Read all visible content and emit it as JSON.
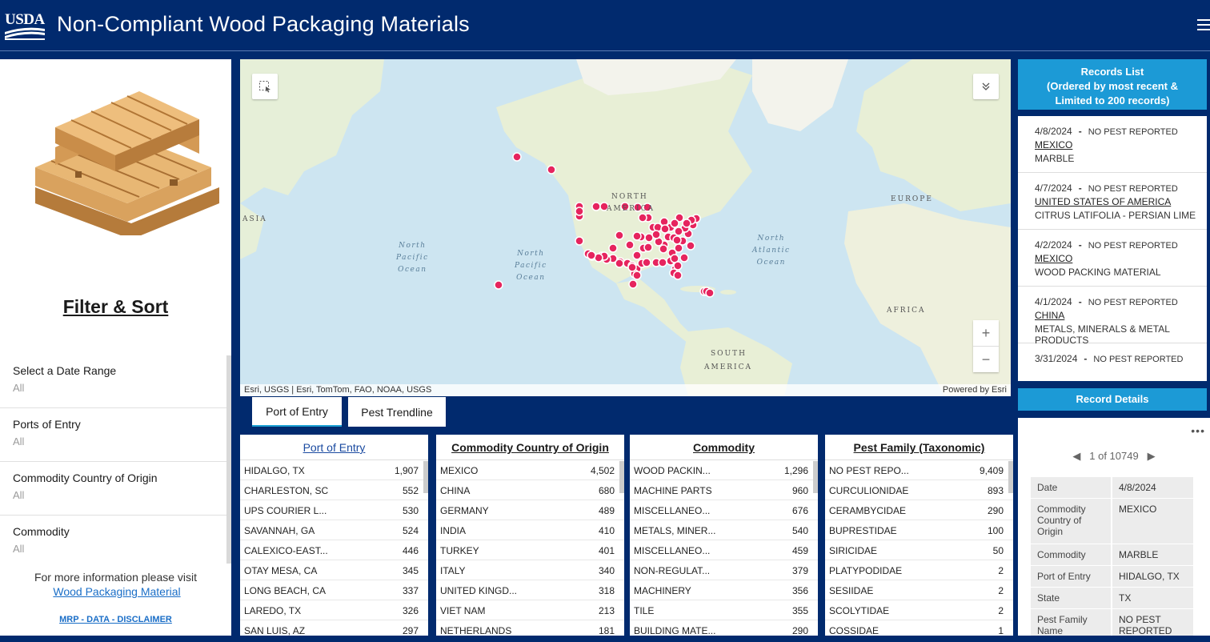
{
  "header": {
    "logo_text": "USDA",
    "title": "Non-Compliant Wood Packaging Materials"
  },
  "left": {
    "filter_title": "Filter & Sort",
    "filters": [
      {
        "label": "Select a Date Range",
        "value": "All"
      },
      {
        "label": "Ports of Entry",
        "value": "All"
      },
      {
        "label": "Commodity Country of Origin",
        "value": "All"
      },
      {
        "label": "Commodity",
        "value": "All"
      }
    ],
    "more_info": "For more information please visit",
    "more_link": "Wood Packaging Material",
    "mrp_link": "MRP - DATA - DISCLAIMER"
  },
  "map": {
    "labels": {
      "asia": "ASIA",
      "north_america_1": "NORTH",
      "north_america_2": "AMERICA",
      "europe": "EUROPE",
      "africa": "AFRICA",
      "south_america_1": "SOUTH",
      "south_america_2": "AMERICA"
    },
    "oceans": {
      "np1": [
        "North",
        "Pacific",
        "Ocean"
      ],
      "np2": [
        "North",
        "Pacific",
        "Ocean"
      ],
      "na": [
        "North",
        "Atlantic",
        "Ocean"
      ]
    },
    "attribution_left": "Esri, USGS | Esri, TomTom, FAO, NOAA, USGS",
    "attribution_right": "Powered by Esri",
    "marker_color": "#e6245e"
  },
  "tabs": [
    {
      "label": "Port of Entry"
    },
    {
      "label": "Pest Trendline"
    }
  ],
  "lists": [
    {
      "title": "Port of Entry",
      "rows": [
        [
          "HIDALGO, TX",
          "1,907"
        ],
        [
          "CHARLESTON, SC",
          "552"
        ],
        [
          "UPS COURIER L...",
          "530"
        ],
        [
          "SAVANNAH, GA",
          "524"
        ],
        [
          "CALEXICO-EAST...",
          "446"
        ],
        [
          "OTAY MESA, CA",
          "345"
        ],
        [
          "LONG BEACH, CA",
          "337"
        ],
        [
          "LAREDO, TX",
          "326"
        ],
        [
          "SAN LUIS, AZ",
          "297"
        ]
      ]
    },
    {
      "title": "Commodity Country of Origin",
      "rows": [
        [
          "MEXICO",
          "4,502"
        ],
        [
          "CHINA",
          "680"
        ],
        [
          "GERMANY",
          "489"
        ],
        [
          "INDIA",
          "410"
        ],
        [
          "TURKEY",
          "401"
        ],
        [
          "ITALY",
          "340"
        ],
        [
          "UNITED KINGD...",
          "318"
        ],
        [
          "VIET NAM",
          "213"
        ],
        [
          "NETHERLANDS",
          "181"
        ]
      ]
    },
    {
      "title": "Commodity",
      "rows": [
        [
          "WOOD PACKIN...",
          "1,296"
        ],
        [
          "MACHINE PARTS",
          "960"
        ],
        [
          "MISCELLANEO...",
          "676"
        ],
        [
          "METALS, MINER...",
          "540"
        ],
        [
          "MISCELLANEO...",
          "459"
        ],
        [
          "NON-REGULAT...",
          "379"
        ],
        [
          "MACHINERY",
          "356"
        ],
        [
          "TILE",
          "355"
        ],
        [
          "BUILDING MATE...",
          "290"
        ]
      ]
    },
    {
      "title": "Pest Family (Taxonomic)",
      "rows": [
        [
          "NO PEST REPO...",
          "9,409"
        ],
        [
          "CURCULIONIDAE",
          "893"
        ],
        [
          "CERAMBYCIDAE",
          "290"
        ],
        [
          "BUPRESTIDAE",
          "100"
        ],
        [
          "SIRICIDAE",
          "50"
        ],
        [
          "PLATYPODIDAE",
          "2"
        ],
        [
          "SESIIDAE",
          "2"
        ],
        [
          "SCOLYTIDAE",
          "2"
        ],
        [
          "COSSIDAE",
          "1"
        ]
      ]
    }
  ],
  "records": {
    "header": "Records List\n(Ordered by most recent &\nLimited to 200 records)",
    "header_lines": [
      "Records List",
      "(Ordered by most recent &",
      "Limited to 200 records)"
    ],
    "items": [
      {
        "date": "4/8/2024",
        "pest": "NO PEST REPORTED",
        "country": "MEXICO",
        "commodity": "MARBLE"
      },
      {
        "date": "4/7/2024",
        "pest": "NO PEST REPORTED",
        "country": "UNITED STATES OF AMERICA",
        "commodity": "CITRUS LATIFOLIA - PERSIAN LIME"
      },
      {
        "date": "4/2/2024",
        "pest": "NO PEST REPORTED",
        "country": "MEXICO",
        "commodity": "WOOD PACKING MATERIAL"
      },
      {
        "date": "4/1/2024",
        "pest": "NO PEST REPORTED",
        "country": "CHINA",
        "commodity": "METALS, MINERALS & METAL PRODUCTS"
      },
      {
        "date": "3/31/2024",
        "pest": "NO PEST REPORTED",
        "country": "",
        "commodity": ""
      }
    ]
  },
  "details": {
    "header": "Record Details",
    "pager": "1 of 10749",
    "rows": [
      {
        "k": "Date",
        "v": "4/8/2024"
      },
      {
        "k": "Commodity Country of Origin",
        "v": "MEXICO"
      },
      {
        "k": "Commodity",
        "v": "MARBLE"
      },
      {
        "k": "Port of Entry",
        "v": "HIDALGO, TX"
      },
      {
        "k": "State",
        "v": "TX"
      },
      {
        "k": "Pest Family Name",
        "v": "NO PEST REPORTED"
      }
    ]
  }
}
